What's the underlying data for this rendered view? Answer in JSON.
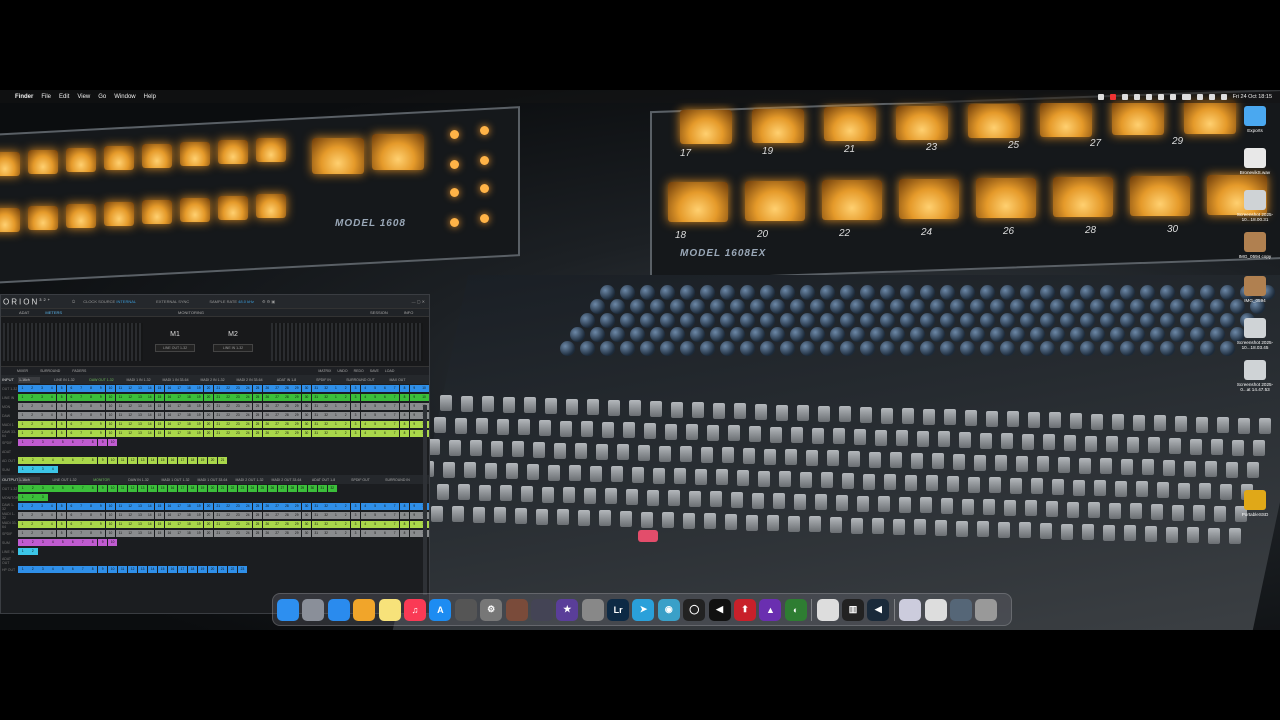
{
  "menubar": {
    "apple": "",
    "app_name": "Finder",
    "items": [
      "File",
      "Edit",
      "View",
      "Go",
      "Window",
      "Help"
    ],
    "clock": "Fri 24 Oct  18:15"
  },
  "background": {
    "brand_left": "MODEL 1608",
    "brand_right": "MODEL 1608EX",
    "meter_numbers_top": [
      "17",
      "19",
      "21",
      "23",
      "25",
      "27",
      "29"
    ],
    "meter_numbers_bottom": [
      "18",
      "20",
      "22",
      "24",
      "26",
      "28",
      "30"
    ]
  },
  "desktop_icons": [
    {
      "label": "Exports",
      "icon": "folder-icon",
      "color": "#4aa8f0"
    },
    {
      "label": "BronevikS.wav",
      "icon": "audio-file-icon",
      "color": "#e8e8e8"
    },
    {
      "label": "Screenshot 2025-10...18.00.31",
      "icon": "screenshot-icon",
      "color": "#cfd3d6"
    },
    {
      "label": "IMG_0594 copy",
      "icon": "image-icon",
      "color": "#b08050"
    },
    {
      "label": "IMG_0594",
      "icon": "image-icon",
      "color": "#b08050"
    },
    {
      "label": "Screenshot 2025-10...18.03.45",
      "icon": "screenshot-icon",
      "color": "#cfd3d6"
    },
    {
      "label": "Screenshot 2025-0...at 14.47.53",
      "icon": "screenshot-icon",
      "color": "#cfd3d6"
    },
    {
      "label": "PortableSSD",
      "icon": "drive-icon",
      "color": "#e0a818"
    }
  ],
  "app": {
    "logo": "ORION",
    "logo_suffix": "32+",
    "clock_source_label": "CLOCK SOURCE",
    "clock_source_value": "INTERNAL",
    "external_sync_label": "EXTERNAL SYNC",
    "sample_rate_label": "SAMPLE RATE",
    "sample_rate_value": "48.0 kHz",
    "tabs": [
      "ADAT",
      "METERS",
      "MONITORING",
      "SESSION",
      "INFO"
    ],
    "monitor": {
      "m1": "M1",
      "m2": "M2",
      "m1_sel": "LINE OUT 1-32",
      "m2_sel": "LINE IN 1-32"
    },
    "subtabs": [
      "MIXER",
      "SURROUND",
      "FADERS",
      "MATRIX",
      "UNDO",
      "REDO",
      "SAVE",
      "LOAD"
    ],
    "input": {
      "label": "INPUT",
      "selector": "1-16ch",
      "columns": [
        "LINE IN 1-32",
        "DAW OUT 1-32",
        "MADI 1 IN 1-32",
        "MADI 1 IN 33-64",
        "MADI 2 IN 1-32",
        "MADI 2 IN 33-64",
        "ADAT IN 1-8",
        "SPDIF IN",
        "SURROUND OUT",
        "MAX OUT"
      ],
      "rows": [
        "OUT 1-32",
        "LINE IN",
        "MON",
        "DAW",
        "MADI 1",
        "DAW 33-64",
        "SPDIF",
        "ADAT",
        "AD OUT",
        "SUM"
      ]
    },
    "output": {
      "label": "OUTPUT",
      "selector": "1-16ch",
      "columns": [
        "LINE OUT 1-32",
        "MONITOR",
        "DAW IN 1-32",
        "MADI 1 OUT 1-32",
        "MADI 1 OUT 33-64",
        "MADI 2 OUT 1-32",
        "MADI 2 OUT 33-64",
        "ADAT OUT 1-8",
        "SPDIF OUT",
        "SURROUND IN"
      ],
      "rows": [
        "OUT 1-32",
        "MONITOR",
        "DAW 1-32",
        "MADI 1-32",
        "MADI 33-64",
        "SPDIF",
        "SUM",
        "LINE IN",
        "ADAT OUT",
        "HP OUT"
      ]
    }
  },
  "dock": [
    {
      "name": "finder-icon",
      "color": "#2d8ff0",
      "glyph": ""
    },
    {
      "name": "launchpad-icon",
      "color": "#8a8f99",
      "glyph": ""
    },
    {
      "name": "safari-icon",
      "color": "#2a8bee",
      "glyph": ""
    },
    {
      "name": "photos-icon",
      "color": "#f1a52a",
      "glyph": ""
    },
    {
      "name": "notes-icon",
      "color": "#f7e27a",
      "glyph": ""
    },
    {
      "name": "music-icon",
      "color": "#fa3a55",
      "glyph": "♫"
    },
    {
      "name": "app-store-icon",
      "color": "#1d8cf2",
      "glyph": "A"
    },
    {
      "name": "utility-icon",
      "color": "#555",
      "glyph": ""
    },
    {
      "name": "system-settings-icon",
      "color": "#777",
      "glyph": "⚙"
    },
    {
      "name": "app-icon",
      "color": "#7a4b3a",
      "glyph": ""
    },
    {
      "name": "app-icon",
      "color": "#445",
      "glyph": ""
    },
    {
      "name": "app-icon",
      "color": "#5a3e99",
      "glyph": "★"
    },
    {
      "name": "app-icon",
      "color": "#888",
      "glyph": ""
    },
    {
      "name": "lightroom-icon",
      "color": "#0d2a45",
      "glyph": "Lr"
    },
    {
      "name": "telegram-icon",
      "color": "#2aa0da",
      "glyph": "➤"
    },
    {
      "name": "app-icon",
      "color": "#3aa0c8",
      "glyph": "◉"
    },
    {
      "name": "app-icon",
      "color": "#222",
      "glyph": "◯"
    },
    {
      "name": "app-icon",
      "color": "#111",
      "glyph": "◀"
    },
    {
      "name": "app-icon",
      "color": "#c8202a",
      "glyph": "⬆"
    },
    {
      "name": "app-icon",
      "color": "#6a2fb0",
      "glyph": "▲"
    },
    {
      "name": "app-icon",
      "color": "#2e7d32",
      "glyph": "◐"
    },
    {
      "name": "app-icon",
      "color": "#ddd",
      "glyph": ""
    },
    {
      "name": "piano-icon",
      "color": "#222",
      "glyph": "▥"
    },
    {
      "name": "app-icon",
      "color": "#1a2a3a",
      "glyph": "◀"
    },
    {
      "name": "document-icon",
      "color": "#ccd",
      "glyph": ""
    },
    {
      "name": "app-icon",
      "color": "#ddd",
      "glyph": ""
    },
    {
      "name": "downloads-stack-icon",
      "color": "#567",
      "glyph": ""
    },
    {
      "name": "trash-icon",
      "color": "#999",
      "glyph": ""
    }
  ]
}
